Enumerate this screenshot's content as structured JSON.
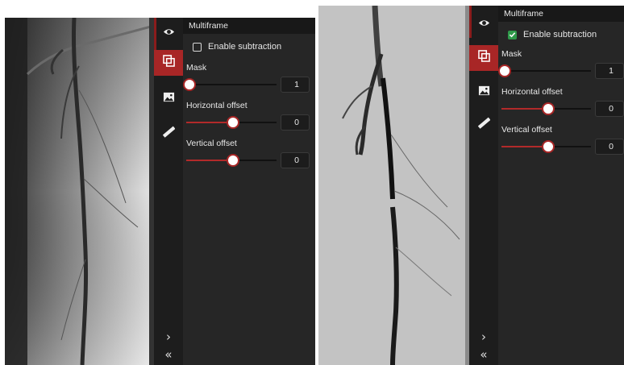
{
  "left": {
    "panel_title": "Multiframe",
    "subtraction": {
      "label": "Enable subtraction",
      "checked": false
    },
    "sliders": [
      {
        "label": "Mask",
        "value": "1",
        "level": 0.02
      },
      {
        "label": "Horizontal offset",
        "value": "0",
        "level": 0.5
      },
      {
        "label": "Vertical offset",
        "value": "0",
        "level": 0.5
      }
    ],
    "rail": {
      "expand_glyph": "›",
      "collapse_glyph": "«"
    }
  },
  "right": {
    "panel_title": "Multiframe",
    "subtraction": {
      "label": "Enable subtraction",
      "checked": true
    },
    "sliders": [
      {
        "label": "Mask",
        "value": "1",
        "level": 0.02
      },
      {
        "label": "Horizontal offset",
        "value": "0",
        "level": 0.5
      },
      {
        "label": "Vertical offset",
        "value": "0",
        "level": 0.5
      }
    ],
    "rail": {
      "expand_glyph": "›",
      "collapse_glyph": "«"
    }
  },
  "icons": [
    "eye-icon",
    "layers-icon",
    "image-icon",
    "ruler-icon"
  ],
  "colors": {
    "accent": "#a82626",
    "check_on": "#2f9a4a",
    "panel_bg": "#262626",
    "rail_bg": "#1d1d1d"
  }
}
